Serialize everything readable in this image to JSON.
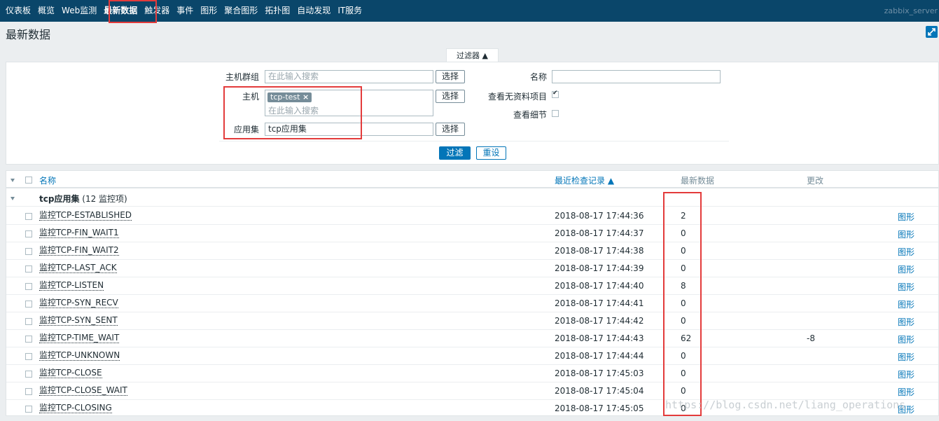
{
  "nav": {
    "items": [
      "仪表板",
      "概览",
      "Web监测",
      "最新数据",
      "触发器",
      "事件",
      "图形",
      "聚合图形",
      "拓扑图",
      "自动发现",
      "IT服务"
    ],
    "active": "最新数据",
    "server": "zabbix_server"
  },
  "page_title": "最新数据",
  "filter": {
    "tab_label": "过滤器 ▲",
    "host_group": {
      "label": "主机群组",
      "placeholder": "在此输入搜索",
      "button": "选择"
    },
    "host": {
      "label": "主机",
      "chip": "tcp-test",
      "placeholder": "在此输入搜索",
      "button": "选择"
    },
    "application": {
      "label": "应用集",
      "value": "tcp应用集",
      "button": "选择"
    },
    "name": {
      "label": "名称",
      "value": ""
    },
    "show_items_without_data": {
      "label": "查看无资料项目",
      "checked": true
    },
    "show_details": {
      "label": "查看细节",
      "checked": false
    },
    "apply_button": "过滤",
    "reset_button": "重设"
  },
  "table": {
    "headers": {
      "name": "名称",
      "last_check": "最近检查记录 ▲",
      "last_value": "最新数据",
      "change": "更改"
    },
    "application_group": {
      "name": "tcp应用集",
      "count": "(12 监控项)"
    },
    "rows": [
      {
        "name": "监控TCP-ESTABLISHED",
        "last_check": "2018-08-17 17:44:36",
        "last_value": "2",
        "change": "",
        "action": "图形"
      },
      {
        "name": "监控TCP-FIN_WAIT1",
        "last_check": "2018-08-17 17:44:37",
        "last_value": "0",
        "change": "",
        "action": "图形"
      },
      {
        "name": "监控TCP-FIN_WAIT2",
        "last_check": "2018-08-17 17:44:38",
        "last_value": "0",
        "change": "",
        "action": "图形"
      },
      {
        "name": "监控TCP-LAST_ACK",
        "last_check": "2018-08-17 17:44:39",
        "last_value": "0",
        "change": "",
        "action": "图形"
      },
      {
        "name": "监控TCP-LISTEN",
        "last_check": "2018-08-17 17:44:40",
        "last_value": "8",
        "change": "",
        "action": "图形"
      },
      {
        "name": "监控TCP-SYN_RECV",
        "last_check": "2018-08-17 17:44:41",
        "last_value": "0",
        "change": "",
        "action": "图形"
      },
      {
        "name": "监控TCP-SYN_SENT",
        "last_check": "2018-08-17 17:44:42",
        "last_value": "0",
        "change": "",
        "action": "图形"
      },
      {
        "name": "监控TCP-TIME_WAIT",
        "last_check": "2018-08-17 17:44:43",
        "last_value": "62",
        "change": "-8",
        "action": "图形"
      },
      {
        "name": "监控TCP-UNKNOWN",
        "last_check": "2018-08-17 17:44:44",
        "last_value": "0",
        "change": "",
        "action": "图形"
      },
      {
        "name": "监控TCP-CLOSE",
        "last_check": "2018-08-17 17:45:03",
        "last_value": "0",
        "change": "",
        "action": "图形"
      },
      {
        "name": "监控TCP-CLOSE_WAIT",
        "last_check": "2018-08-17 17:45:04",
        "last_value": "0",
        "change": "",
        "action": "图形"
      },
      {
        "name": "监控TCP-CLOSING",
        "last_check": "2018-08-17 17:45:05",
        "last_value": "0",
        "change": "",
        "action": "图形"
      }
    ]
  },
  "watermark": "https://blog.csdn.net/liang_operations",
  "colors": {
    "nav_bg": "#0a466a",
    "link": "#0275b8",
    "highlight_box": "#e33b3b"
  }
}
